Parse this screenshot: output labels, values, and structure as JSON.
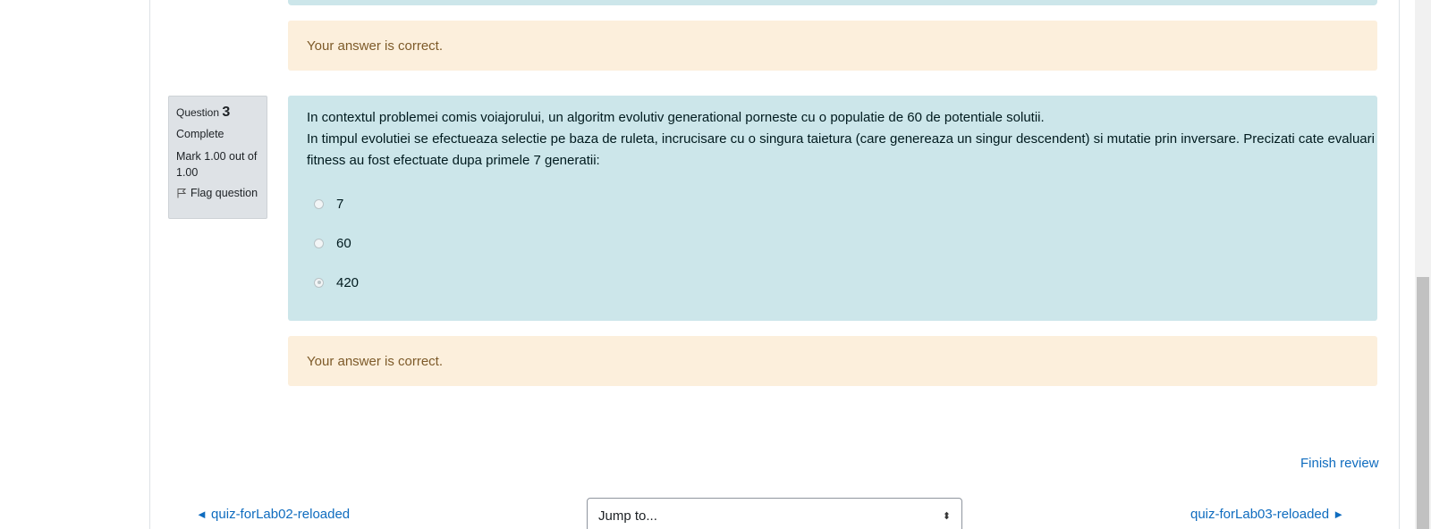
{
  "previous_question": {
    "feedback": "Your answer is correct."
  },
  "question_info": {
    "label": "Question",
    "number": "3",
    "state": "Complete",
    "grade": "Mark 1.00 out of 1.00",
    "flag_label": "Flag question"
  },
  "question": {
    "text_line1": "In contextul problemei comis voiajorului, un algoritm evolutiv generational porneste cu o populatie de 60 de potentiale solutii.",
    "text_line2": "In timpul evolutiei se efectueaza selectie pe baza de ruleta, incrucisare cu o singura taietura (care genereaza un singur descendent) si mutatie prin inversare. Precizati cate evaluari ale functiei de",
    "text_line3": "fitness au fost efectuate dupa primele 7 generatii:",
    "options": [
      {
        "label": "7",
        "checked": false
      },
      {
        "label": "60",
        "checked": false
      },
      {
        "label": "420",
        "checked": true
      }
    ],
    "feedback": "Your answer is correct."
  },
  "navigation": {
    "finish_review": "Finish review",
    "prev_activity": "quiz-forLab02-reloaded",
    "next_activity": "quiz-forLab03-reloaded",
    "jump_to": "Jump to..."
  }
}
